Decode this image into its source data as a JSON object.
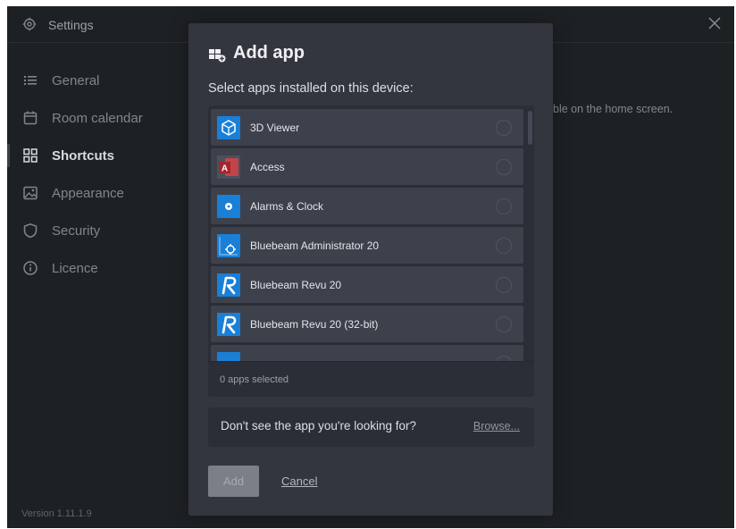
{
  "window": {
    "title": "Settings",
    "version": "Version 1.11.1.9",
    "hint_text": "ble on the home screen."
  },
  "sidebar": {
    "items": [
      {
        "label": "General",
        "icon": "list-icon",
        "active": false
      },
      {
        "label": "Room calendar",
        "icon": "calendar-icon",
        "active": false
      },
      {
        "label": "Shortcuts",
        "icon": "grid-icon",
        "active": true
      },
      {
        "label": "Appearance",
        "icon": "image-icon",
        "active": false
      },
      {
        "label": "Security",
        "icon": "shield-icon",
        "active": false
      },
      {
        "label": "Licence",
        "icon": "info-icon",
        "active": false
      }
    ]
  },
  "dialog": {
    "title": "Add app",
    "subtitle": "Select apps installed on this device:",
    "apps": [
      {
        "name": "3D Viewer",
        "icon": "3d-viewer-icon",
        "selected": false
      },
      {
        "name": "Access",
        "icon": "access-icon",
        "selected": false
      },
      {
        "name": "Alarms & Clock",
        "icon": "alarms-clock-icon",
        "selected": false
      },
      {
        "name": "Bluebeam Administrator 20",
        "icon": "bluebeam-admin-icon",
        "selected": false
      },
      {
        "name": "Bluebeam Revu 20",
        "icon": "bluebeam-revu-icon",
        "selected": false
      },
      {
        "name": "Bluebeam Revu 20 (32-bit)",
        "icon": "bluebeam-revu-icon",
        "selected": false
      },
      {
        "name": "",
        "icon": "bluebeam-icon",
        "selected": false
      }
    ],
    "selected_count": "0 apps selected",
    "browse_prompt": "Don't see the app you're looking for?",
    "browse_label": "Browse...",
    "add_label": "Add",
    "cancel_label": "Cancel"
  },
  "colors": {
    "window_bg": "#1e2124",
    "dialog_bg": "#33363f",
    "row_bg": "#3d414c",
    "app_blue": "#1a7fd6",
    "access_red": "#a4262c"
  }
}
